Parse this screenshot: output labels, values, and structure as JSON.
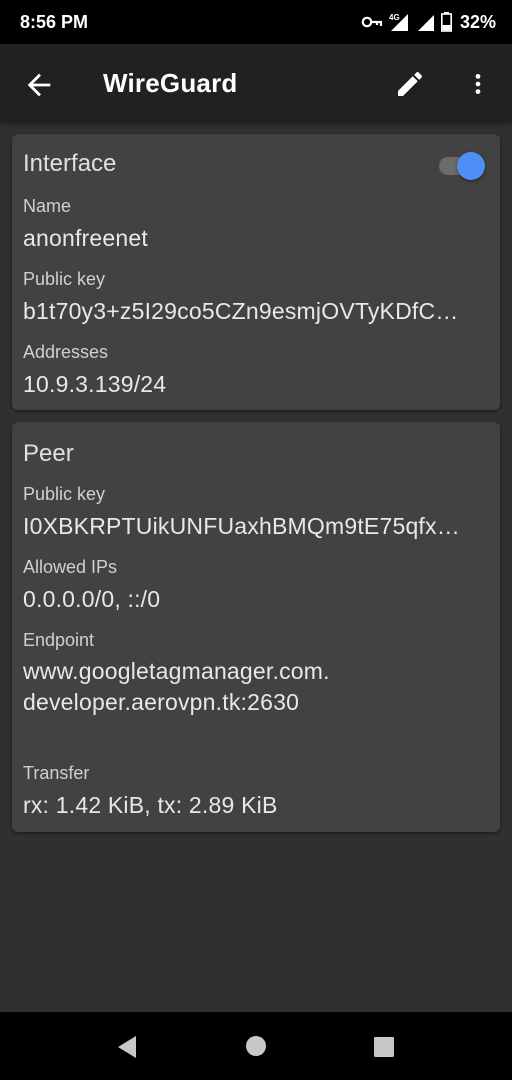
{
  "status_bar": {
    "time": "8:56 PM",
    "battery_percent": "32%",
    "network": "4G",
    "icons": [
      "vpn-key-icon",
      "signal-4g-icon",
      "signal-icon",
      "battery-icon"
    ]
  },
  "app_bar": {
    "title": "WireGuard",
    "icons": [
      "back-arrow-icon",
      "edit-pencil-icon",
      "more-vert-icon"
    ]
  },
  "interface": {
    "title": "Interface",
    "enabled": true,
    "accent_color": "#4f8ef7",
    "name_label": "Name",
    "name_value": "anonfreenet",
    "public_key_label": "Public key",
    "public_key_value": "b1t70y3+z5I29co5CZn9esmjOVTyKDfC…",
    "addresses_label": "Addresses",
    "addresses_value": "10.9.3.139/24"
  },
  "peer": {
    "title": "Peer",
    "public_key_label": "Public key",
    "public_key_value": "I0XBKRPTUikUNFUaxhBMQm9tE75qfx…",
    "allowed_ips_label": "Allowed IPs",
    "allowed_ips_value": "0.0.0.0/0, ::/0",
    "endpoint_label": "Endpoint",
    "endpoint_value": "www.googletagmanager.com.developer.aerovpn.tk:2630",
    "transfer_label": "Transfer",
    "transfer_value": "rx: 1.42 KiB, tx: 2.89 KiB"
  },
  "nav_bar": {
    "icons": [
      "nav-back-icon",
      "nav-home-icon",
      "nav-recents-icon"
    ]
  }
}
